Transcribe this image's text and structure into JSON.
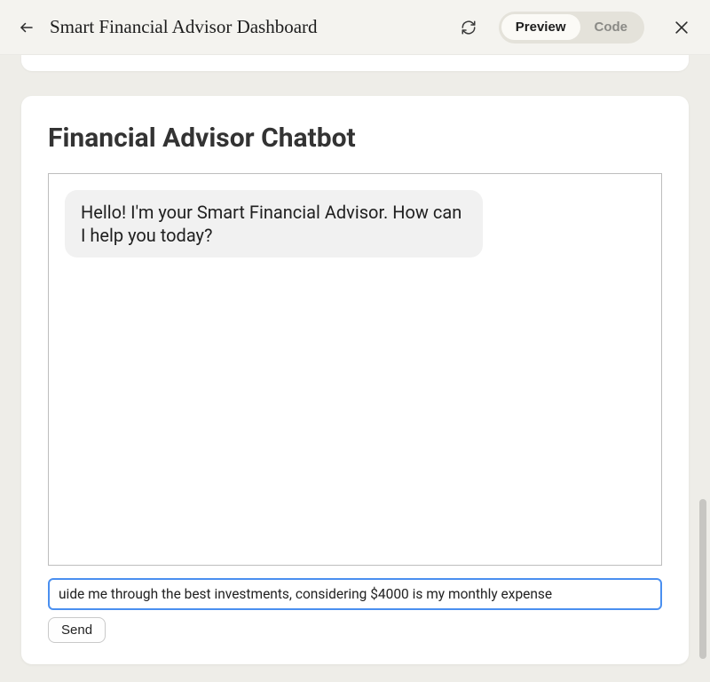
{
  "header": {
    "title": "Smart Financial Advisor Dashboard",
    "tabs": {
      "preview": "Preview",
      "code": "Code"
    }
  },
  "chat": {
    "heading": "Financial Advisor Chatbot",
    "messages": [
      {
        "role": "bot",
        "text": "Hello! I'm your Smart Financial Advisor. How can I help you today?"
      }
    ],
    "input_value": "uide me through the best investments, considering $4000 is my monthly expense",
    "send_label": "Send"
  }
}
